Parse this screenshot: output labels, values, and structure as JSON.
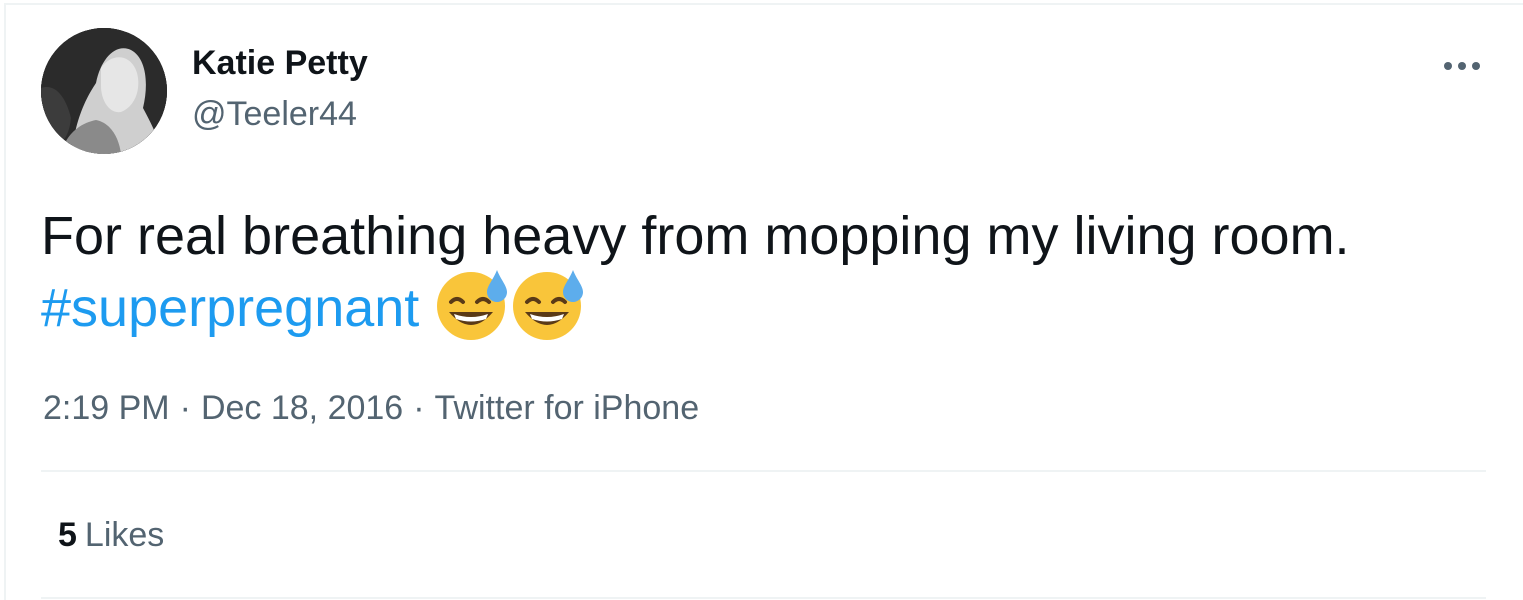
{
  "author": {
    "display_name": "Katie Petty",
    "handle": "@Teeler44",
    "avatar_icon": "profile-photo"
  },
  "tweet": {
    "text_line1": "For real breathing heavy from mopping my living room.",
    "hashtag": "#superpregnant",
    "emojis": [
      "grinning-face-with-sweat",
      "grinning-face-with-sweat"
    ]
  },
  "meta": {
    "time": "2:19 PM",
    "separator": "·",
    "date": "Dec 18, 2016",
    "source": "Twitter for iPhone"
  },
  "stats": {
    "likes_count": "5",
    "likes_label": "Likes"
  },
  "more_icon": "ellipsis-icon",
  "colors": {
    "hashtag": "#1d9bf0",
    "secondary_text": "#536471",
    "primary_text": "#0f1419",
    "divider": "#eff3f4"
  }
}
